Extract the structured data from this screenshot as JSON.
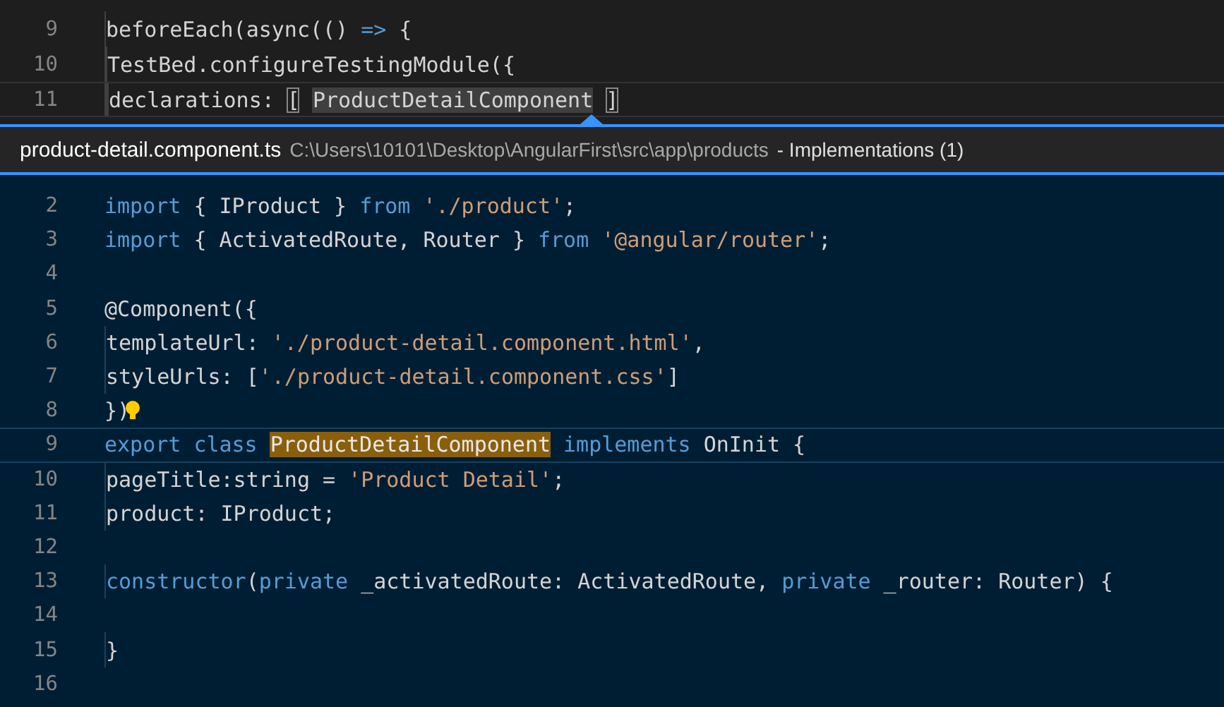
{
  "editor": {
    "lines": [
      {
        "number": "9",
        "current": false,
        "tokens": [
          {
            "kind": "plain",
            "text": "  beforeEach(async(()",
            "gap_after": true
          },
          {
            "kind": "keyword",
            "text": "=>",
            "gap_after": true
          },
          {
            "kind": "plain",
            "text": "{"
          }
        ]
      },
      {
        "number": "10",
        "current": false,
        "tokens": [
          {
            "kind": "plain",
            "text": "    TestBed.configureTestingModule({"
          }
        ]
      },
      {
        "number": "11",
        "current": true,
        "tokens": [
          {
            "kind": "plain",
            "text": "      declarations:",
            "gap_after": true
          },
          {
            "kind": "bracket",
            "text": "[",
            "gap_after": true
          },
          {
            "kind": "reference",
            "text": "ProductDetailComponent",
            "gap_after": true
          },
          {
            "kind": "bracket",
            "text": "]"
          }
        ]
      }
    ]
  },
  "peek": {
    "file": "product-detail.component.ts",
    "path": "C:\\Users\\10101\\Desktop\\AngularFirst\\src\\app\\products",
    "title": "- Implementations (1)",
    "lines": [
      {
        "number": "2",
        "current": false,
        "tokens": [
          {
            "kind": "keyword",
            "text": "import",
            "gap_after": true
          },
          {
            "kind": "plain",
            "text": "{ IProduct }",
            "gap_after": true
          },
          {
            "kind": "keyword",
            "text": "from",
            "gap_after": true
          },
          {
            "kind": "string",
            "text": "'./product'"
          },
          {
            "kind": "plain",
            "text": ";"
          }
        ]
      },
      {
        "number": "3",
        "current": false,
        "tokens": [
          {
            "kind": "keyword",
            "text": "import",
            "gap_after": true
          },
          {
            "kind": "plain",
            "text": "{ ActivatedRoute, Router }",
            "gap_after": true
          },
          {
            "kind": "keyword",
            "text": "from",
            "gap_after": true
          },
          {
            "kind": "string",
            "text": "'@angular/router'"
          },
          {
            "kind": "plain",
            "text": ";"
          }
        ]
      },
      {
        "number": "4",
        "current": false
      },
      {
        "number": "5",
        "current": false,
        "tokens": [
          {
            "kind": "plain",
            "text": "@Component({"
          }
        ]
      },
      {
        "number": "6",
        "current": false,
        "tokens": [
          {
            "kind": "plain",
            "text": "  templateUrl:",
            "gap_after": true
          },
          {
            "kind": "string",
            "text": "'./product-detail.component.html'"
          },
          {
            "kind": "plain",
            "text": ","
          }
        ]
      },
      {
        "number": "7",
        "current": false,
        "tokens": [
          {
            "kind": "plain",
            "text": "  styleUrls: ["
          },
          {
            "kind": "string",
            "text": "'./product-detail.component.css'"
          },
          {
            "kind": "plain",
            "text": "]"
          }
        ]
      },
      {
        "number": "8",
        "current": false,
        "lightbulb": true,
        "tokens": [
          {
            "kind": "plain",
            "text": "})"
          }
        ]
      },
      {
        "number": "9",
        "current": true,
        "tokens": [
          {
            "kind": "keyword",
            "text": "export",
            "gap_after": true
          },
          {
            "kind": "keyword",
            "text": "class",
            "gap_after": true
          },
          {
            "kind": "match",
            "text": "ProductDetailComponent",
            "gap_after": true
          },
          {
            "kind": "keyword",
            "text": "implements",
            "gap_after": true
          },
          {
            "kind": "plain",
            "text": "OnInit {"
          }
        ]
      },
      {
        "number": "10",
        "current": false,
        "tokens": [
          {
            "kind": "plain",
            "text": "  pageTitle:string =",
            "gap_after": true
          },
          {
            "kind": "string",
            "text": "'Product Detail'"
          },
          {
            "kind": "plain",
            "text": ";"
          }
        ]
      },
      {
        "number": "11",
        "current": false,
        "tokens": [
          {
            "kind": "plain",
            "text": "  product: IProduct;"
          }
        ]
      },
      {
        "number": "12",
        "current": false
      },
      {
        "number": "13",
        "current": false,
        "tokens": [
          {
            "kind": "keyword",
            "text": "  constructor"
          },
          {
            "kind": "plain",
            "text": "("
          },
          {
            "kind": "keyword",
            "text": "private",
            "gap_after": true
          },
          {
            "kind": "plain",
            "text": "_activatedRoute: ActivatedRoute,",
            "gap_after": true
          },
          {
            "kind": "keyword",
            "text": "private",
            "gap_after": true
          },
          {
            "kind": "plain",
            "text": "_router: Router) {"
          }
        ]
      },
      {
        "number": "14",
        "current": false
      },
      {
        "number": "15",
        "current": false,
        "tokens": [
          {
            "kind": "plain",
            "text": "  }"
          }
        ]
      },
      {
        "number": "16",
        "current": false
      }
    ]
  }
}
